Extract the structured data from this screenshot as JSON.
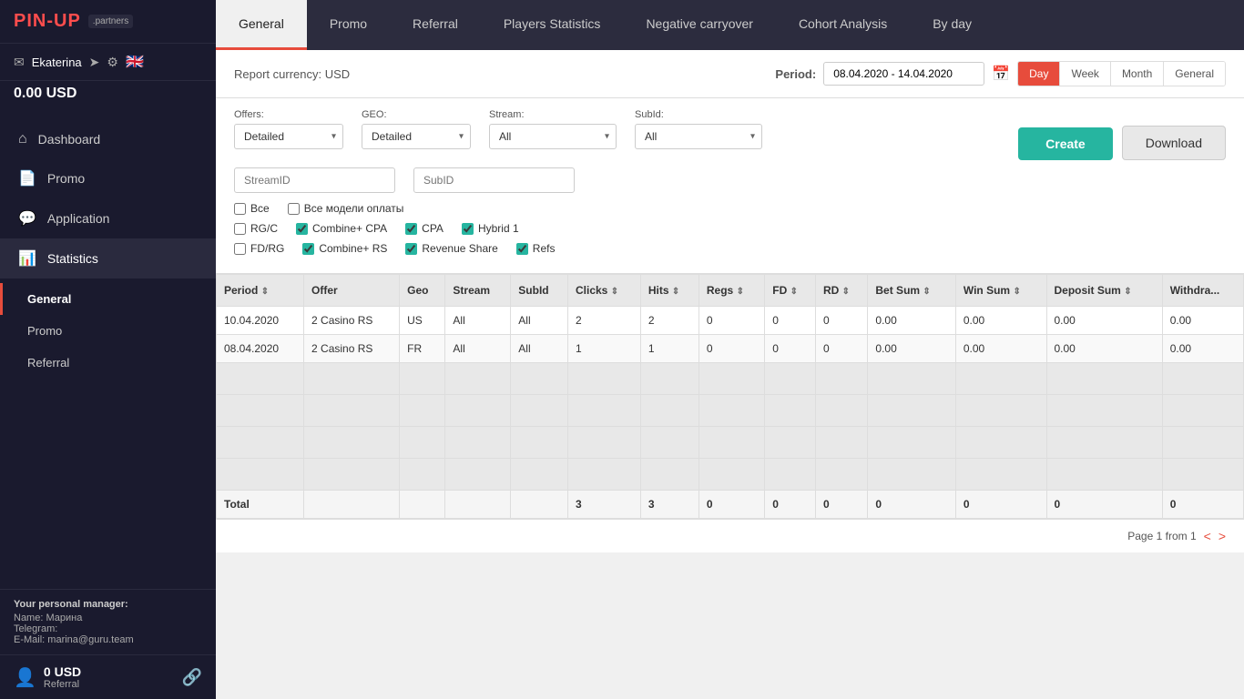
{
  "logo": {
    "text": "PIN-UP",
    "partners": ".partners"
  },
  "user": {
    "name": "Ekaterina",
    "balance": "0.00 USD"
  },
  "sidebar": {
    "nav_items": [
      {
        "id": "dashboard",
        "label": "Dashboard",
        "icon": "⌂"
      },
      {
        "id": "promo",
        "label": "Promo",
        "icon": "📄"
      },
      {
        "id": "application",
        "label": "Application",
        "icon": "💬"
      },
      {
        "id": "statistics",
        "label": "Statistics",
        "icon": "📊",
        "active": true
      }
    ],
    "sub_items": [
      {
        "id": "general",
        "label": "General",
        "active": true
      },
      {
        "id": "promo",
        "label": "Promo"
      },
      {
        "id": "referral",
        "label": "Referral"
      }
    ],
    "manager": {
      "label": "Your personal manager:",
      "name_label": "Name:",
      "name": "Марина",
      "telegram_label": "Telegram:",
      "email_label": "E-Mail:",
      "email": "marina@guru.team"
    },
    "footer": {
      "amount": "0 USD",
      "label": "Referral"
    }
  },
  "top_nav": {
    "tabs": [
      {
        "id": "general",
        "label": "General",
        "active": true
      },
      {
        "id": "promo",
        "label": "Promo"
      },
      {
        "id": "referral",
        "label": "Referral"
      },
      {
        "id": "players-statistics",
        "label": "Players Statistics"
      },
      {
        "id": "negative-carryover",
        "label": "Negative carryover"
      },
      {
        "id": "cohort-analysis",
        "label": "Cohort Analysis"
      },
      {
        "id": "by-day",
        "label": "By day"
      }
    ]
  },
  "report": {
    "currency_label": "Report currency: USD",
    "period_label": "Period:",
    "period_value": "08.04.2020 - 14.04.2020",
    "period_tabs": [
      {
        "id": "day",
        "label": "Day",
        "active": true
      },
      {
        "id": "week",
        "label": "Week"
      },
      {
        "id": "month",
        "label": "Month"
      },
      {
        "id": "general",
        "label": "General"
      }
    ]
  },
  "filters": {
    "offers_label": "Offers:",
    "offers_value": "Detailed",
    "geo_label": "GEO:",
    "geo_value": "Detailed",
    "stream_label": "Stream:",
    "stream_value": "All",
    "subid_label": "SubId:",
    "subid_value": "All",
    "streamid_placeholder": "StreamID",
    "subid_placeholder": "SubID",
    "create_btn": "Create",
    "download_btn": "Download",
    "checkboxes": {
      "vse": {
        "label": "Все",
        "checked": false
      },
      "vse_modeli": {
        "label": "Все модели оплаты",
        "checked": false
      },
      "rgc": {
        "label": "RG/C",
        "checked": false
      },
      "combine_cpa": {
        "label": "Combine+ CPA",
        "checked": true
      },
      "cpa": {
        "label": "CPA",
        "checked": true
      },
      "hybrid1": {
        "label": "Hybrid 1",
        "checked": true
      },
      "fd_rg": {
        "label": "FD/RG",
        "checked": false
      },
      "combine_rs": {
        "label": "Combine+ RS",
        "checked": true
      },
      "revenue_share": {
        "label": "Revenue Share",
        "checked": true
      },
      "refs": {
        "label": "Refs",
        "checked": true
      }
    }
  },
  "table": {
    "headers": [
      {
        "id": "period",
        "label": "Period",
        "sortable": true
      },
      {
        "id": "offer",
        "label": "Offer",
        "sortable": false
      },
      {
        "id": "geo",
        "label": "Geo",
        "sortable": false
      },
      {
        "id": "stream",
        "label": "Stream",
        "sortable": false
      },
      {
        "id": "subid",
        "label": "SubId",
        "sortable": false
      },
      {
        "id": "clicks",
        "label": "Clicks",
        "sortable": true
      },
      {
        "id": "hits",
        "label": "Hits",
        "sortable": true
      },
      {
        "id": "regs",
        "label": "Regs",
        "sortable": true
      },
      {
        "id": "fd",
        "label": "FD",
        "sortable": true
      },
      {
        "id": "rd",
        "label": "RD",
        "sortable": true
      },
      {
        "id": "bet_sum",
        "label": "Bet Sum",
        "sortable": true
      },
      {
        "id": "win_sum",
        "label": "Win Sum",
        "sortable": true
      },
      {
        "id": "deposit_sum",
        "label": "Deposit Sum",
        "sortable": true
      },
      {
        "id": "withdrawal",
        "label": "Withdra...",
        "sortable": false
      }
    ],
    "rows": [
      {
        "period": "10.04.2020",
        "offer": "2 Casino RS",
        "geo": "US",
        "stream": "All",
        "subid": "All",
        "clicks": "2",
        "hits": "2",
        "regs": "0",
        "fd": "0",
        "rd": "0",
        "bet_sum": "0.00",
        "win_sum": "0.00",
        "deposit_sum": "0.00",
        "withdrawal": "0.00"
      },
      {
        "period": "08.04.2020",
        "offer": "2 Casino RS",
        "geo": "FR",
        "stream": "All",
        "subid": "All",
        "clicks": "1",
        "hits": "1",
        "regs": "0",
        "fd": "0",
        "rd": "0",
        "bet_sum": "0.00",
        "win_sum": "0.00",
        "deposit_sum": "0.00",
        "withdrawal": "0.00"
      }
    ],
    "empty_rows": 4,
    "total": {
      "label": "Total",
      "clicks": "3",
      "hits": "3",
      "regs": "0",
      "fd": "0",
      "rd": "0",
      "bet_sum": "0",
      "win_sum": "0",
      "deposit_sum": "0",
      "withdrawal": "0"
    }
  },
  "pagination": {
    "text": "Page 1 from 1",
    "prev": "<",
    "next": ">"
  }
}
